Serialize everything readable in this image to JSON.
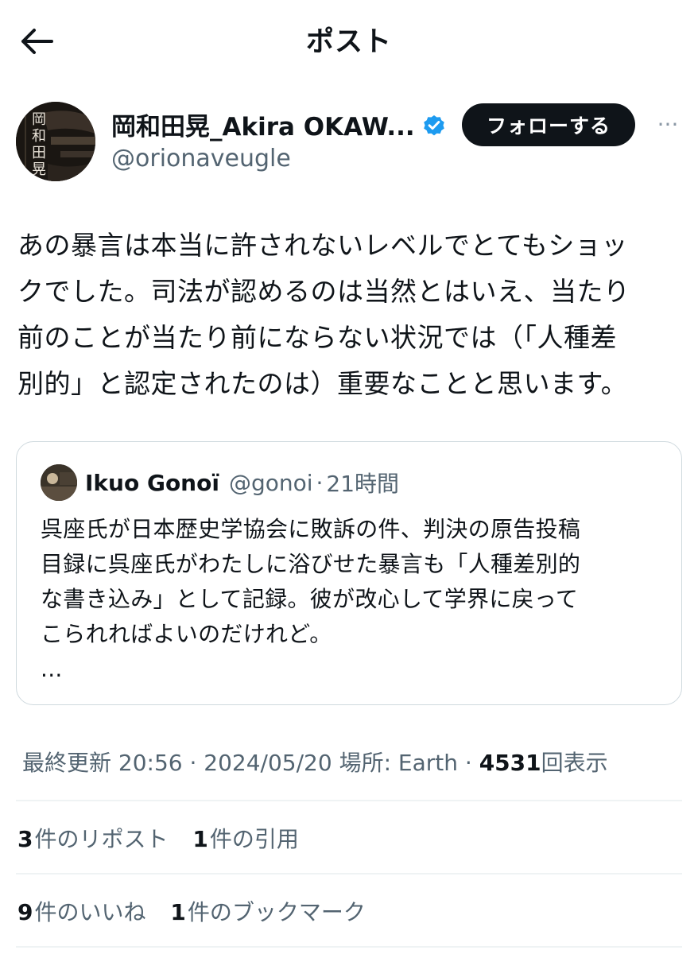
{
  "header": {
    "title": "ポスト"
  },
  "author": {
    "name": "岡和田晃_Akira OKAW...",
    "handle": "@orionaveugle",
    "follow_label": "フォローする",
    "more_label": "···",
    "avatar_text": "岡和田晃"
  },
  "tweet": {
    "lines": [
      "あの暴言は本当に許されないレベルでとてもショッ",
      "クでした。司法が認めるのは当然とはいえ、当たり",
      "前のことが当たり前にならない状況では（「人種差",
      "別的」と認定されたのは）重要なことと思います。"
    ]
  },
  "quote": {
    "name": "Ikuo Gonoï",
    "handle": "@gonoi",
    "dot": "·",
    "time": "21時間",
    "lines": [
      "呉座氏が日本歴史学協会に敗訴の件、判決の原告投稿",
      "目録に呉座氏がわたしに浴びせた暴言も「人種差別的",
      "な書き込み」として記録。彼が改心して学界に戻って",
      "こられればよいのだけれど。",
      "..."
    ]
  },
  "meta": {
    "prefix": "最終更新 20:56 · 2024/05/20  場所: Earth · ",
    "views": "4531",
    "views_label": "回表示"
  },
  "stats": {
    "reposts_count": "3",
    "reposts_label": "件のリポスト",
    "quotes_count": "1",
    "quotes_label": "件の引用",
    "likes_count": "9",
    "likes_label": "件のいいね",
    "bookmarks_count": "1",
    "bookmarks_label": "件のブックマーク"
  },
  "colors": {
    "text": "#0f1419",
    "secondary": "#536471",
    "verified": "#1d9bf0",
    "border": "#cfd9de",
    "divider": "#eff3f4"
  }
}
